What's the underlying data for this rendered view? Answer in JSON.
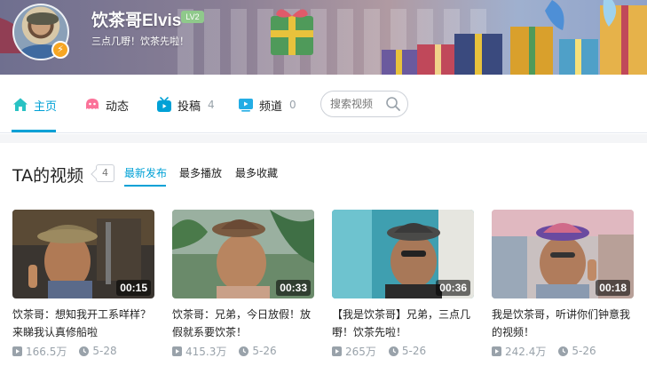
{
  "user": {
    "name": "饮茶哥Elvis",
    "level": "LV2",
    "sign": "三点几嘢！饮茶先啦！"
  },
  "nav": {
    "items": [
      {
        "label": "主页",
        "count": ""
      },
      {
        "label": "动态",
        "count": ""
      },
      {
        "label": "投稿",
        "count": "4"
      },
      {
        "label": "频道",
        "count": "0"
      }
    ]
  },
  "search": {
    "placeholder": "搜索视频"
  },
  "section": {
    "title": "TA的视频",
    "count": "4",
    "sorts": [
      "最新发布",
      "最多播放",
      "最多收藏"
    ]
  },
  "videos": [
    {
      "title": "饮茶哥：想知我开工系咩样？来睇我认真修船啦",
      "duration": "00:15",
      "plays": "166.5万",
      "date": "5-28"
    },
    {
      "title": "饮茶哥：兄弟，今日放假！放假就系要饮茶！",
      "duration": "00:33",
      "plays": "415.3万",
      "date": "5-26"
    },
    {
      "title": "【我是饮茶哥】兄弟，三点几嘢！饮茶先啦！",
      "duration": "00:36",
      "plays": "265万",
      "date": "5-26"
    },
    {
      "title": "我是饮茶哥，听讲你们钟意我的视频！",
      "duration": "00:18",
      "plays": "242.4万",
      "date": "5-26"
    }
  ],
  "colors": {
    "accent": "#00a1d6",
    "muted": "#99a2aa",
    "verify": "#f6a623",
    "level": "#8fc98b"
  },
  "icons": [
    "home-icon",
    "dynamic-icon",
    "upload-icon",
    "channel-icon",
    "search-icon",
    "play-count-icon",
    "clock-icon",
    "verified-icon"
  ]
}
